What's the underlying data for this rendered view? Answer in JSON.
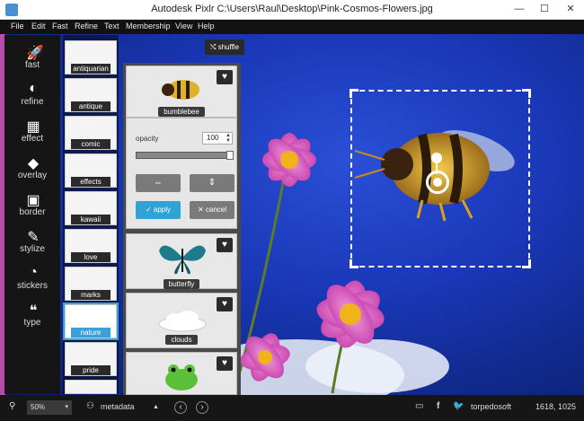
{
  "window": {
    "title": "Autodesk Pixlr   C:\\Users\\Raul\\Desktop\\Pink-Cosmos-Flowers.jpg",
    "min": "—",
    "max": "☐",
    "close": "✕"
  },
  "menu": [
    "File",
    "Edit",
    "Fast",
    "Refine",
    "Text",
    "Membership",
    "View",
    "Help"
  ],
  "tools": [
    {
      "label": "fast",
      "icon": "🚀"
    },
    {
      "label": "refine",
      "icon": "◐"
    },
    {
      "label": "effect",
      "icon": "▦"
    },
    {
      "label": "overlay",
      "icon": "◆"
    },
    {
      "label": "border",
      "icon": "▣"
    },
    {
      "label": "stylize",
      "icon": "✎"
    },
    {
      "label": "stickers",
      "icon": "◔"
    },
    {
      "label": "type",
      "icon": "❝"
    }
  ],
  "thumbs": [
    "antiquarian",
    "antique",
    "comic",
    "effects",
    "kawaii",
    "love",
    "marks",
    "nature",
    "pride",
    ""
  ],
  "shuffle": "⤭ shuffle",
  "panel": {
    "heart": "♥",
    "bumblebee_label": "bumblebee",
    "opacity_label": "opacity",
    "opacity_value": "100",
    "spin_up": "▲",
    "spin_down": "▼",
    "flip_h": "⇔",
    "flip_v": "⇕",
    "apply": "✓ apply",
    "cancel": "✕ cancel",
    "butterfly_label": "butterfly",
    "clouds_label": "clouds"
  },
  "statusbar": {
    "search_icon": "⚲",
    "zoom": "50%",
    "zoom_caret": "▾",
    "metadata_icon": "⚇",
    "metadata": "metadata",
    "up": "▲",
    "prev": "‹",
    "next": "›",
    "info_icon": "▭",
    "facebook": "f",
    "twitter_icon": "🐦",
    "account": "torpedosoft",
    "coords": "1618, 1025"
  },
  "colors": {
    "accent": "#2ea3d6",
    "sky": "#1a38b8"
  }
}
